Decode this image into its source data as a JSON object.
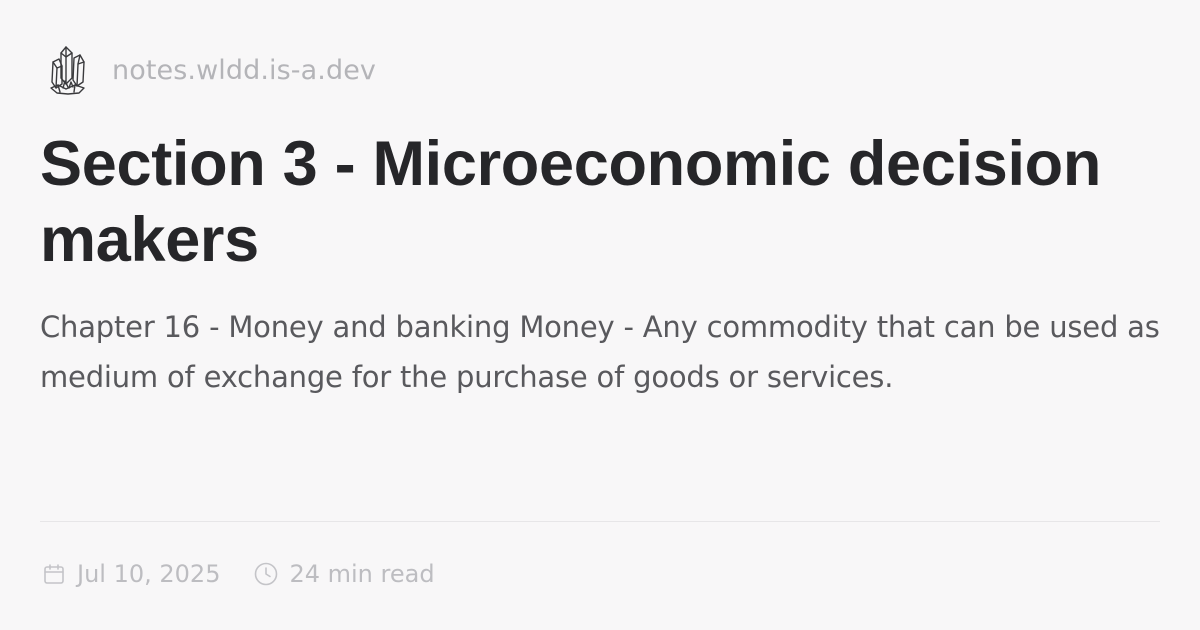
{
  "site": {
    "name": "notes.wldd.is-a.dev",
    "logo_icon": "crystal-cluster-icon"
  },
  "post": {
    "title": "Section 3 - Microeconomic decision makers",
    "excerpt": "Chapter 16 - Money and banking Money - Any commodity that can be used as medium of exchange for the purchase of goods or services."
  },
  "meta": {
    "date": "Jul 10, 2025",
    "date_icon": "calendar-icon",
    "read_time": "24 min read",
    "read_time_icon": "clock-icon"
  },
  "colors": {
    "background": "#f8f7f8",
    "title": "#262629",
    "excerpt": "#59595d",
    "muted": "#b4b4b8",
    "divider": "#e7e6e8"
  }
}
